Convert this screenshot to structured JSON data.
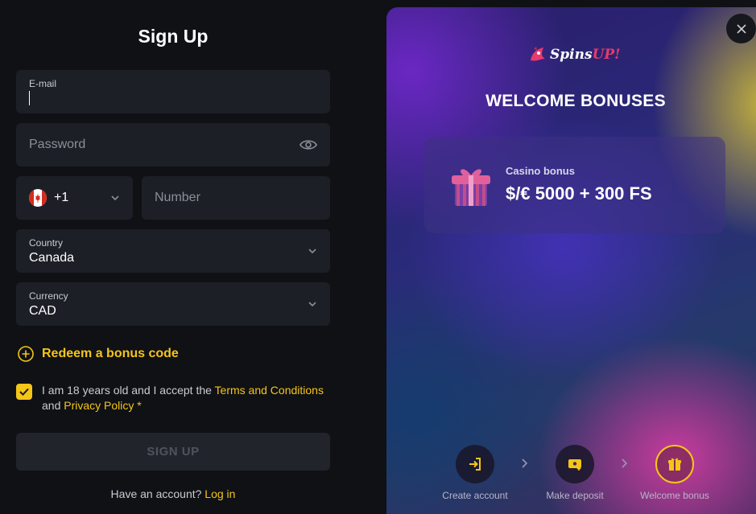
{
  "signup": {
    "title": "Sign Up",
    "email_label": "E-mail",
    "password_placeholder": "Password",
    "phone_code": "+1",
    "number_placeholder": "Number",
    "country_label": "Country",
    "country_value": "Canada",
    "currency_label": "Currency",
    "currency_value": "CAD",
    "redeem_label": "Redeem a bonus code",
    "terms_prefix": "I am 18 years old and I accept the ",
    "terms_link": "Terms and Conditions",
    "terms_and": "and ",
    "privacy_link": "Privacy Policy",
    "required_mark": " *",
    "button_label": "SIGN UP",
    "have_account": "Have an account? ",
    "login_link": "Log in"
  },
  "promo": {
    "logo_text_main": "Spins",
    "logo_text_accent": "UP!",
    "heading": "WELCOME BONUSES",
    "bonus_label": "Casino bonus",
    "bonus_amount": "$/€ 5000 + 300 FS",
    "steps": [
      {
        "label": "Create account"
      },
      {
        "label": "Make deposit"
      },
      {
        "label": "Welcome bonus"
      }
    ]
  },
  "colors": {
    "accent": "#f5c518",
    "field_bg": "#1c1f26",
    "page_bg": "#0f1115"
  }
}
